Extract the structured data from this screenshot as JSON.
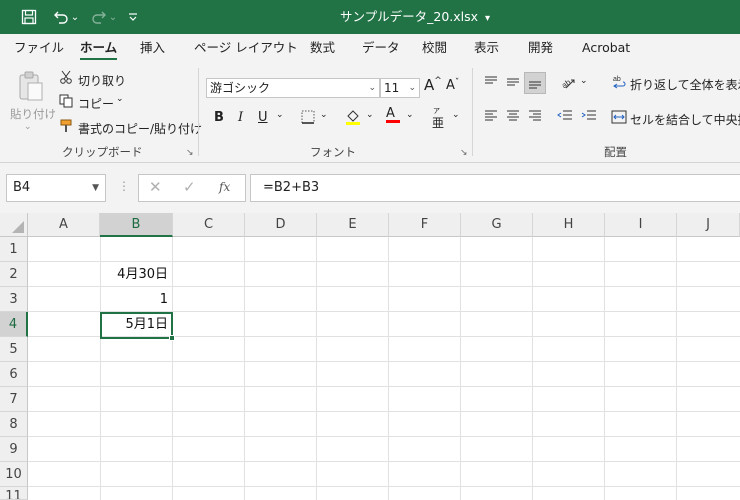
{
  "window": {
    "title": "サンプルデータ_20.xlsx",
    "title_arrow": "▾"
  },
  "qat": {
    "undo_arrow": "⌄",
    "redo_arrow": "⌄"
  },
  "tabs": [
    {
      "label": "ファイル"
    },
    {
      "label": "ホーム"
    },
    {
      "label": "挿入"
    },
    {
      "label": "ページ レイアウト"
    },
    {
      "label": "数式"
    },
    {
      "label": "データ"
    },
    {
      "label": "校閲"
    },
    {
      "label": "表示"
    },
    {
      "label": "開発"
    },
    {
      "label": "Acrobat"
    }
  ],
  "ribbon": {
    "clipboard": {
      "paste": "貼り付け",
      "cut": "切り取り",
      "copy": "コピー",
      "format_painter": "書式のコピー/貼り付け",
      "group_label": "クリップボード"
    },
    "font": {
      "font_name": "游ゴシック",
      "font_size": "11",
      "grow": "A",
      "shrink": "A",
      "bold": "B",
      "italic": "I",
      "underline": "U",
      "font_color_letter": "A",
      "phonetic": "亜",
      "group_label": "フォント",
      "fill_color": "#ffff00",
      "text_color": "#ff0000"
    },
    "alignment": {
      "wrap_text": "折り返して全体を表示す",
      "merge_center": "セルを結合して中央揃え",
      "group_label": "配置"
    }
  },
  "formula_bar": {
    "name_box": "B4",
    "formula": "=B2+B3",
    "fx": "fx"
  },
  "sheet": {
    "columns": [
      "A",
      "B",
      "C",
      "D",
      "E",
      "F",
      "G",
      "H",
      "I",
      "J"
    ],
    "rows": [
      "1",
      "2",
      "3",
      "4",
      "5",
      "6",
      "7",
      "8",
      "9",
      "10",
      "11"
    ],
    "selected_column": "B",
    "selected_row": "4",
    "cells": {
      "B2": "4月30日",
      "B3": "1",
      "B4": "5月1日"
    },
    "accent_color": "#217346"
  }
}
